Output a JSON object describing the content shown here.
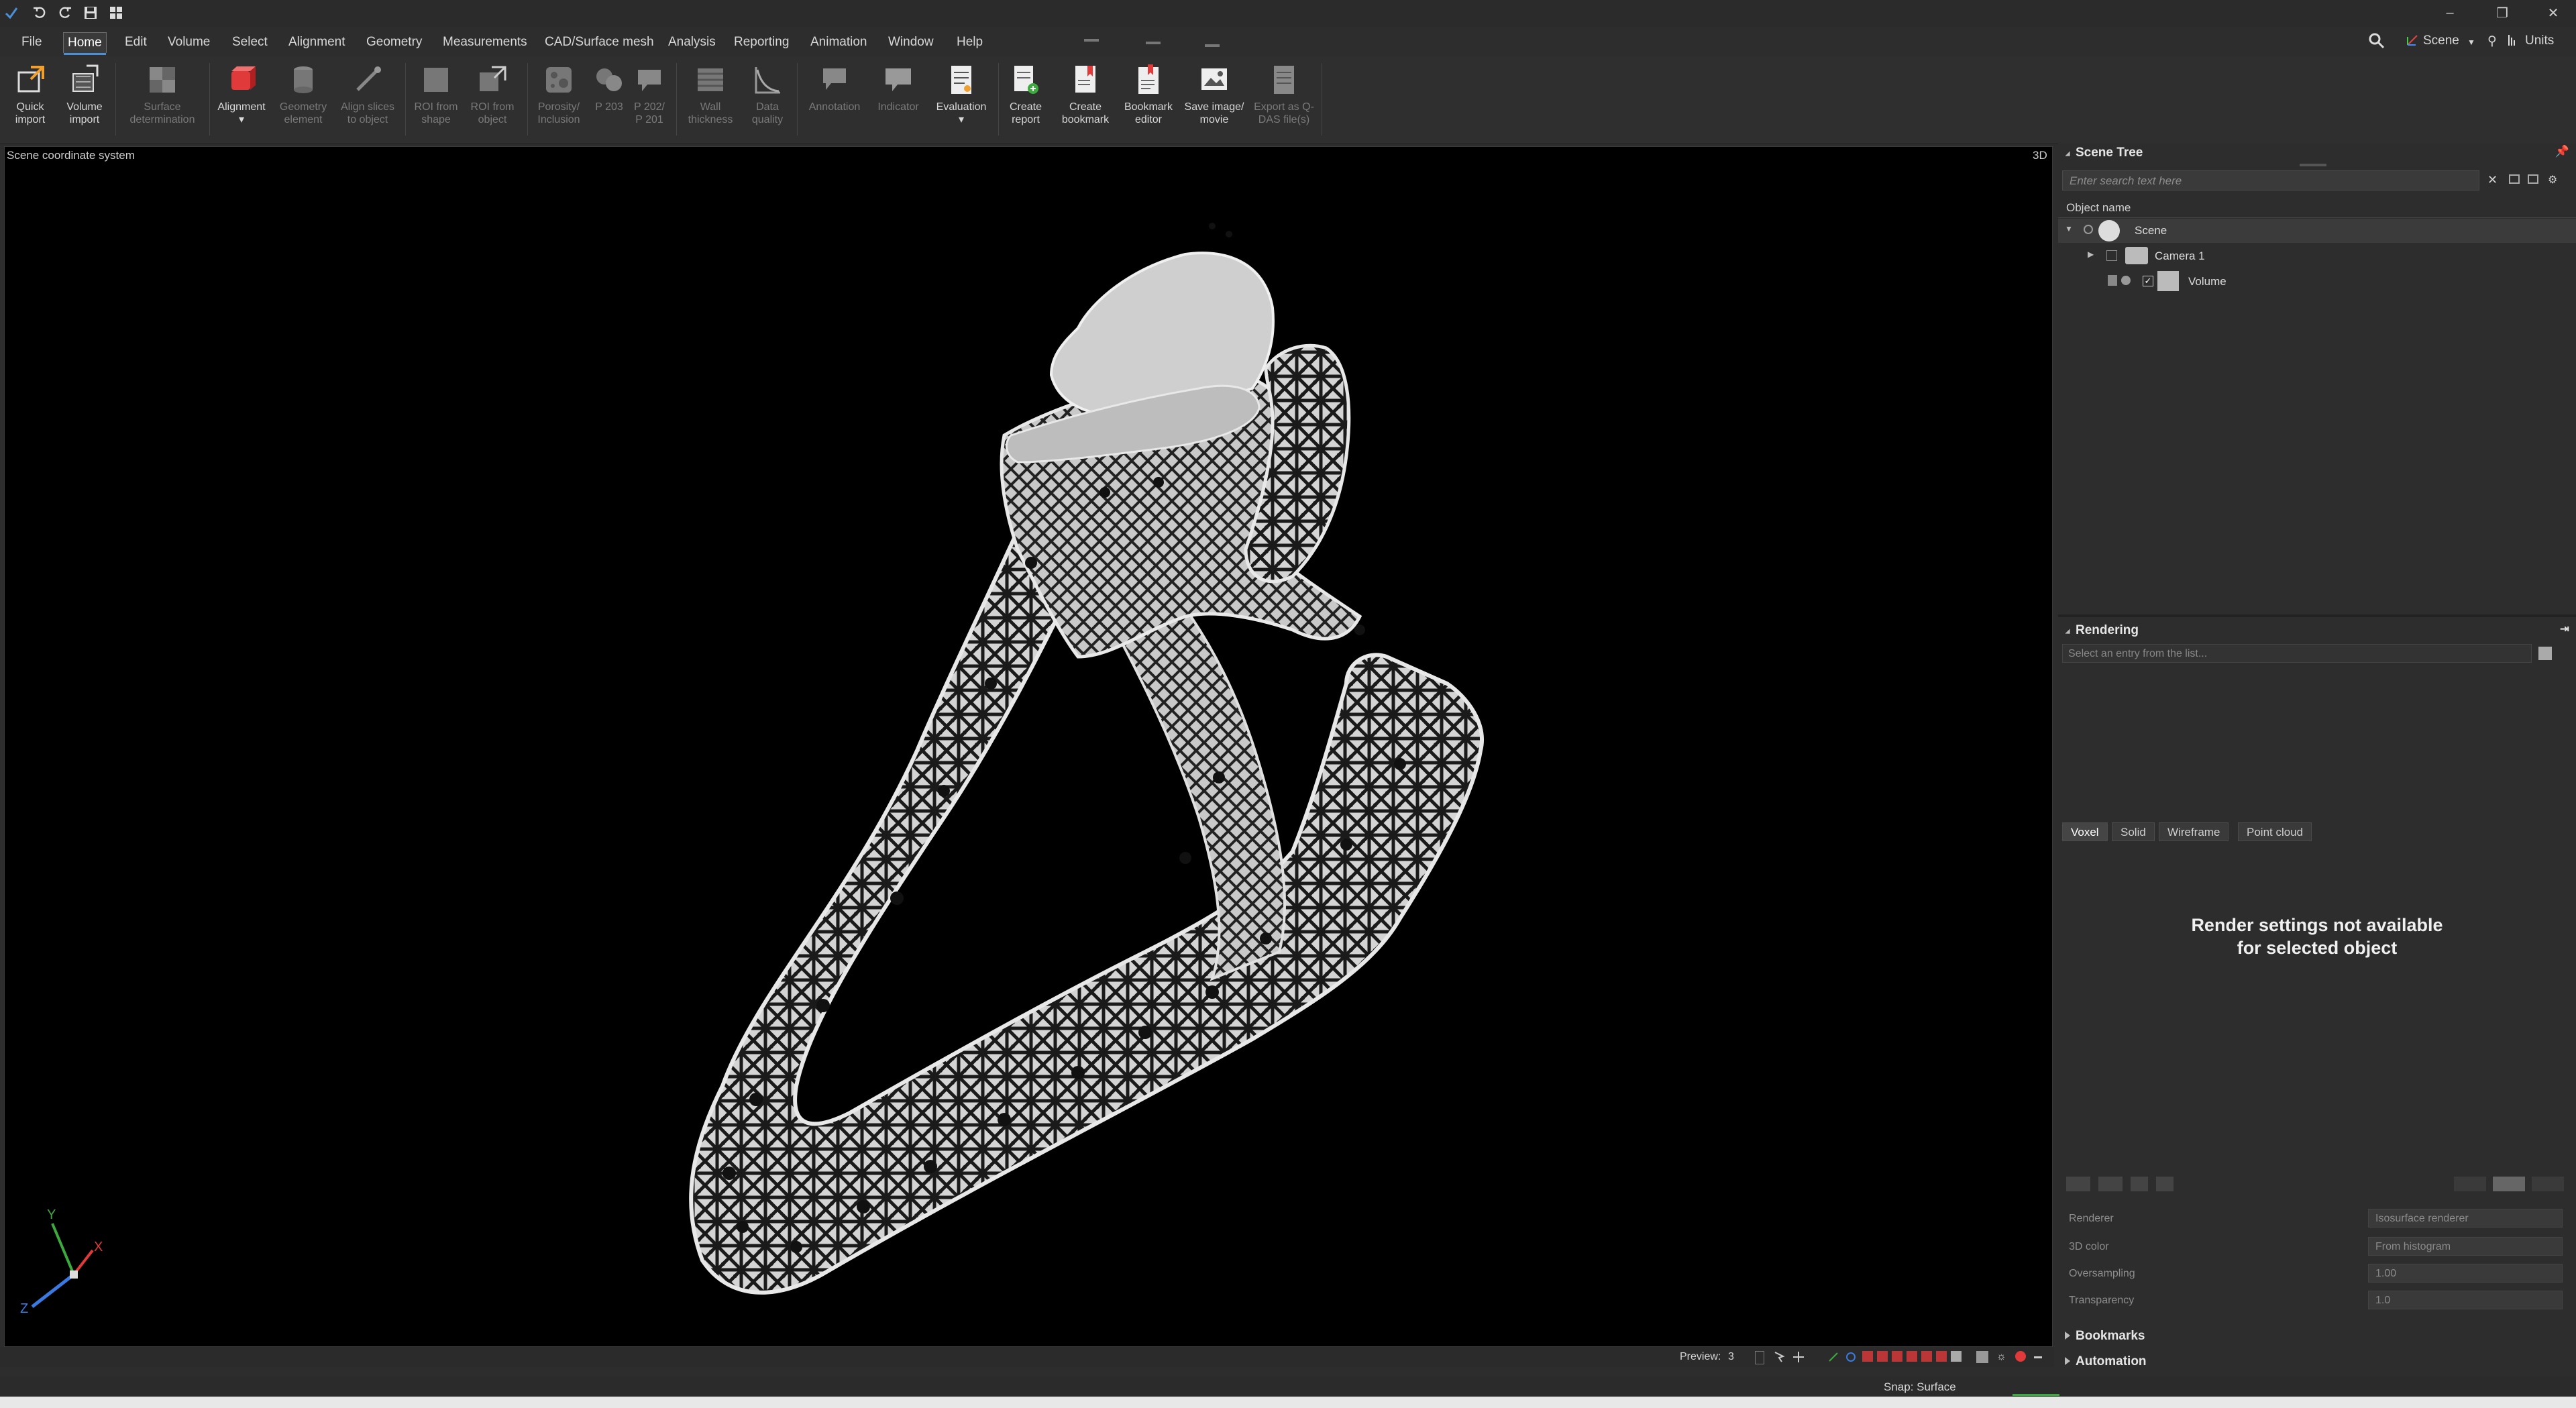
{
  "window": {
    "minimize_glyph": "–",
    "restore_glyph": "❐",
    "close_glyph": "✕",
    "scene_label": "Scene",
    "units_label": "Units"
  },
  "menu": {
    "items": [
      "File",
      "Home",
      "Edit",
      "Volume",
      "Select",
      "Alignment",
      "Geometry",
      "Measurements",
      "CAD/Surface mesh",
      "Analysis",
      "Reporting",
      "Animation",
      "Window",
      "Help"
    ],
    "active": "Home"
  },
  "ribbon": {
    "quick_import": [
      "Quick",
      "import"
    ],
    "volume_import": [
      "Volume",
      "import"
    ],
    "surface_determination": [
      "Surface",
      "determination"
    ],
    "alignment": [
      "Alignment",
      "▾"
    ],
    "geometry_element": [
      "Geometry",
      "element"
    ],
    "align_slices": [
      "Align slices",
      "to object"
    ],
    "roi_from_shape": [
      "ROI from",
      "shape"
    ],
    "roi_from_object": [
      "ROI from",
      "object"
    ],
    "porosity": [
      "Porosity/",
      "Inclusion"
    ],
    "p203": [
      "P 203",
      ""
    ],
    "p202": [
      "P 202/",
      "P 201"
    ],
    "wall_thickness": [
      "Wall",
      "thickness"
    ],
    "data_quality": [
      "Data",
      "quality"
    ],
    "annotation": [
      "Annotation",
      ""
    ],
    "indicator": [
      "Indicator",
      ""
    ],
    "evaluation": [
      "Evaluation",
      "▾"
    ],
    "create_report": [
      "Create",
      "report"
    ],
    "create_bookmark": [
      "Create",
      "bookmark"
    ],
    "bookmark_editor": [
      "Bookmark",
      "editor"
    ],
    "save_image": [
      "Save image/",
      "movie"
    ],
    "export_qdas": [
      "Export as Q-",
      "DAS file(s)"
    ]
  },
  "viewport": {
    "coordinate_label": "Scene coordinate system",
    "mode_label": "3D",
    "axis_labels": {
      "y": "Y",
      "x": "X",
      "z": "Z"
    },
    "preview_label": "Preview:",
    "preview_value": "3"
  },
  "scene_tree": {
    "title": "Scene Tree",
    "search_placeholder": "Enter search text here",
    "column_header": "Object name",
    "items": [
      {
        "label": "Scene"
      },
      {
        "label": "Camera 1"
      },
      {
        "label": "Volume"
      }
    ]
  },
  "rendering": {
    "title": "Rendering",
    "select_placeholder": "Select an entry from the list...",
    "tabs": [
      "Voxel",
      "Solid",
      "Wireframe",
      "Point cloud"
    ],
    "active_tab": "Voxel",
    "message_line1": "Render settings not available",
    "message_line2": "for selected object",
    "properties": [
      {
        "label": "Renderer",
        "value": "Isosurface renderer"
      },
      {
        "label": "3D color",
        "value": "From histogram"
      },
      {
        "label": "Oversampling",
        "value": "1.00"
      },
      {
        "label": "Transparency",
        "value": "1.0"
      }
    ]
  },
  "bookmarks": {
    "title": "Bookmarks"
  },
  "automation": {
    "title": "Automation"
  },
  "status": {
    "snap": "Snap: Surface"
  },
  "colors": {
    "accent": "#4a8fd8",
    "background": "#2d2d2d",
    "viewport": "#000000",
    "red_icon": "#e03a3a"
  },
  "icons": [
    "quick-import-icon",
    "volume-import-icon",
    "surface-determination-icon",
    "alignment-icon",
    "geometry-element-icon",
    "align-slices-icon",
    "roi-shape-icon",
    "roi-object-icon",
    "porosity-icon",
    "p203-icon",
    "p202-icon",
    "wall-thickness-icon",
    "data-quality-icon",
    "annotation-icon",
    "indicator-icon",
    "evaluation-icon",
    "create-report-icon",
    "create-bookmark-icon",
    "bookmark-editor-icon",
    "save-image-icon",
    "export-qdas-icon"
  ]
}
